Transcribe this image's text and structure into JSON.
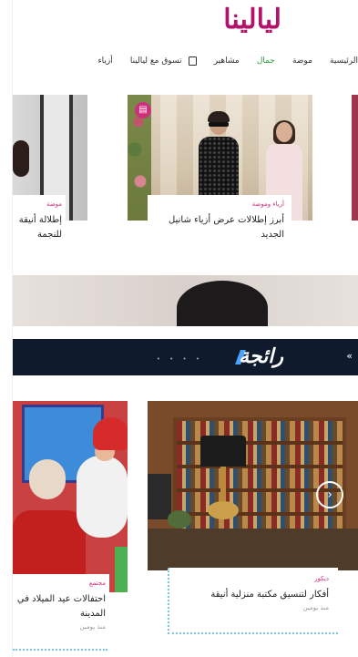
{
  "brand": {
    "logo": "ليالينا"
  },
  "nav": {
    "items": [
      {
        "label": "الرئيسية"
      },
      {
        "label": "موضة"
      },
      {
        "label": "جمال"
      },
      {
        "label": "مشاهير"
      },
      {
        "label": "تسوق مع ليالينا"
      },
      {
        "label": "أزياء"
      }
    ],
    "active_index": 2
  },
  "carousel_top": {
    "main": {
      "meta": "أزياء وموضة",
      "title": "أبرز إطلالات عرض أزياء شانيل الجديد",
      "badge_icon": "gallery-icon"
    },
    "left": {
      "meta": "موضة",
      "title": "إطلالة أنيقة للنجمة"
    }
  },
  "band": {
    "brand": "رائجة",
    "right_text": "»"
  },
  "bottom_cards": {
    "main": {
      "meta": "ديكور",
      "title": "أفكار لتنسيق مكتبة منزلية أنيقة",
      "date": "منذ يومين"
    },
    "left": {
      "meta": "مجتمع",
      "title": "احتفالات عيد الميلاد في المدينة",
      "date": "منذ يومين"
    }
  }
}
